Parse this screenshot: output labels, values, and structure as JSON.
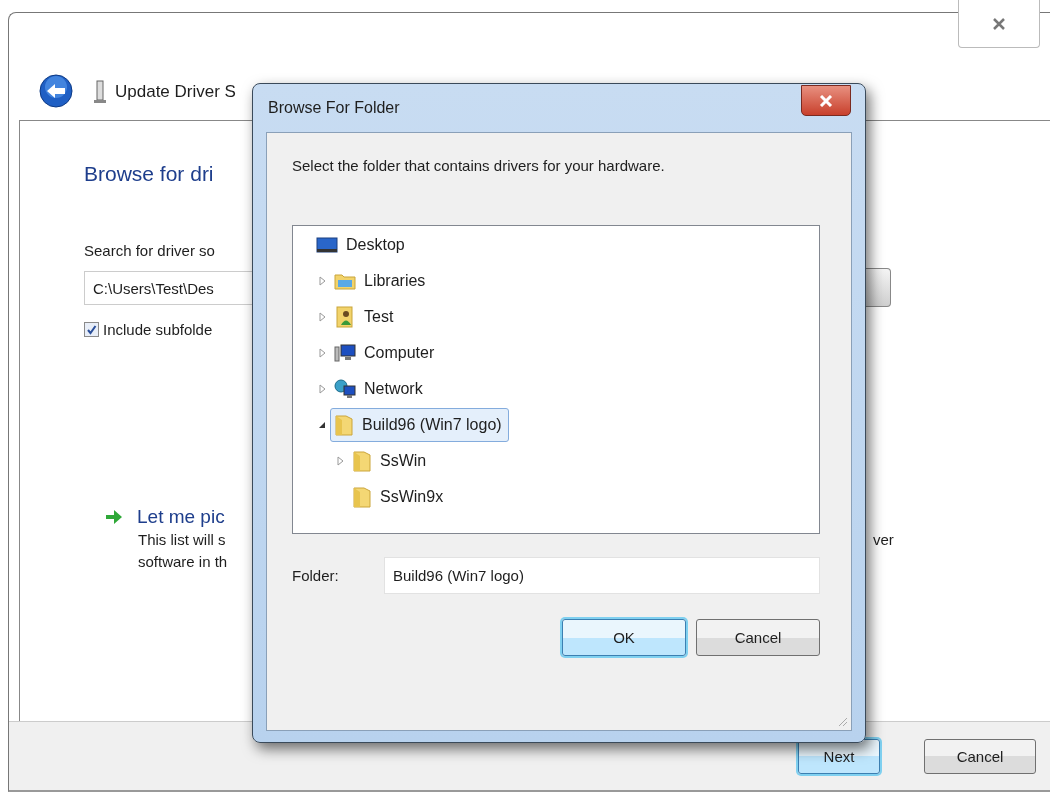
{
  "wizard": {
    "title": "Update Driver S",
    "heading": "Browse for dri",
    "search_label": "Search for driver so",
    "path_field": {
      "value": "C:\\Users\\Test\\Des"
    },
    "include_subfolders": {
      "label": "Include subfolde",
      "checked": true
    },
    "pick_option": {
      "title": "Let me pic",
      "description_lines": [
        "This list will s",
        "software in th"
      ],
      "description_tail": "ver"
    },
    "buttons": [
      {
        "label": "Next",
        "default": true
      },
      {
        "label": "Cancel",
        "default": false
      }
    ]
  },
  "dialog": {
    "title": "Browse For Folder",
    "instruction": "Select the folder that contains drivers for your hardware.",
    "tree": {
      "label": "Desktop",
      "kind": "desktop",
      "selected": false,
      "children": [
        {
          "label": "Libraries",
          "kind": "libraries",
          "expanded": false,
          "selected": false
        },
        {
          "label": "Test",
          "kind": "user",
          "expanded": false,
          "selected": false
        },
        {
          "label": "Computer",
          "kind": "computer",
          "expanded": false,
          "selected": false
        },
        {
          "label": "Network",
          "kind": "network",
          "expanded": false,
          "selected": false
        },
        {
          "label": "Build96 (Win7 logo)",
          "kind": "folder",
          "expanded": true,
          "selected": true,
          "children": [
            {
              "label": "SsWin",
              "kind": "folder",
              "expanded": false,
              "selected": false
            },
            {
              "label": "SsWin9x",
              "kind": "folder",
              "selected": false
            }
          ]
        }
      ]
    },
    "folder": {
      "label": "Folder:",
      "value": "Build96 (Win7 logo)"
    },
    "buttons": [
      {
        "label": "OK",
        "default": true
      },
      {
        "label": "Cancel",
        "default": false
      }
    ]
  }
}
